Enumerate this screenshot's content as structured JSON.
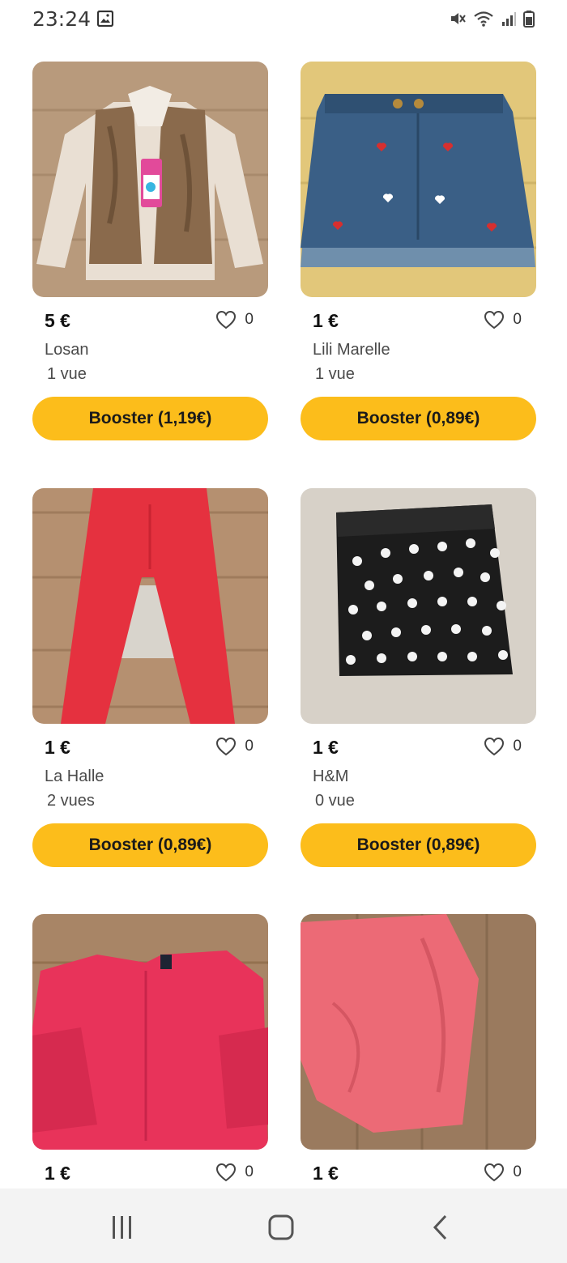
{
  "status_bar": {
    "time": "23:24",
    "icons": [
      "gallery-icon",
      "mute-icon",
      "wifi-icon",
      "signal-icon",
      "battery-icon"
    ]
  },
  "colors": {
    "booster": "#fcbd1b",
    "nav_background": "#f3f3f3"
  },
  "items": [
    {
      "price": "5 €",
      "brand": "Losan",
      "views": "1 vue",
      "likes": "0",
      "booster": "Booster (1,19€)",
      "photo": "beige cardigan with faux fur vest"
    },
    {
      "price": "1 €",
      "brand": "Lili Marelle",
      "views": "1 vue",
      "likes": "0",
      "booster": "Booster (0,89€)",
      "photo": "denim skirt with hearts"
    },
    {
      "price": "1 €",
      "brand": "La Halle",
      "views": "2 vues",
      "likes": "0",
      "booster": "Booster (0,89€)",
      "photo": "red leggings"
    },
    {
      "price": "1 €",
      "brand": "H&M",
      "views": "0 vue",
      "likes": "0",
      "booster": "Booster (0,89€)",
      "photo": "black polka dot skirt"
    },
    {
      "price": "1 €",
      "likes": "0",
      "photo": "pink cardigan"
    },
    {
      "price": "1 €",
      "likes": "0",
      "photo": "pink top"
    }
  ],
  "nav": [
    "recent-apps-icon",
    "home-icon",
    "back-icon"
  ]
}
